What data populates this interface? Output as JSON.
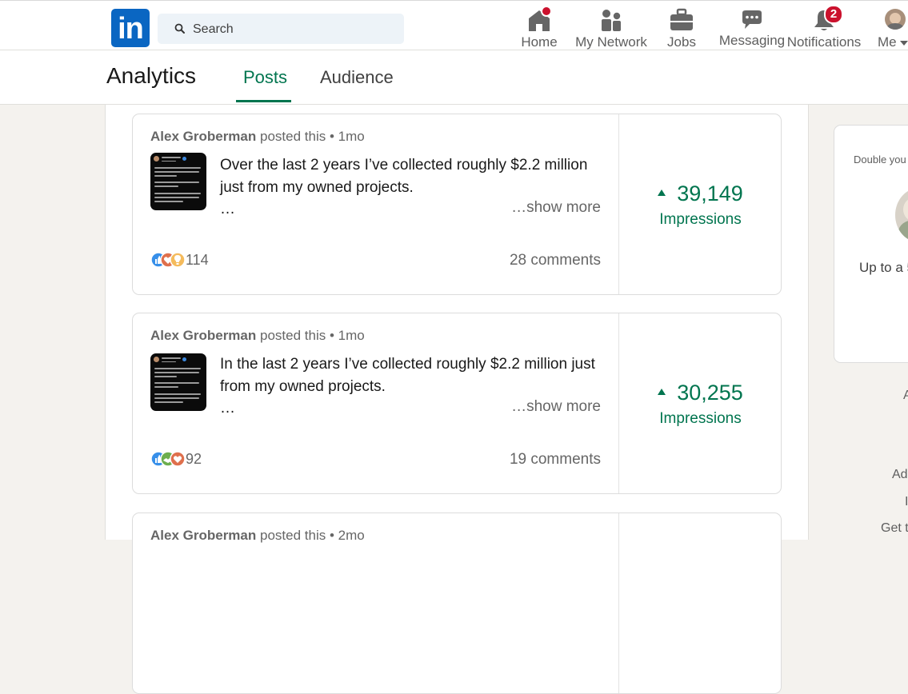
{
  "nav": {
    "logo_text": "in",
    "search_placeholder": "Search",
    "items": [
      {
        "label": "Home",
        "icon": "home-icon"
      },
      {
        "label": "My Network",
        "icon": "network-icon"
      },
      {
        "label": "Jobs",
        "icon": "briefcase-icon"
      },
      {
        "label": "Messaging",
        "icon": "messaging-icon"
      },
      {
        "label": "Notifications",
        "icon": "bell-icon",
        "badge": "2"
      },
      {
        "label": "Me",
        "icon": "avatar"
      }
    ]
  },
  "analytics": {
    "title": "Analytics",
    "tabs": [
      {
        "label": "Posts",
        "active": true
      },
      {
        "label": "Audience",
        "active": false
      }
    ]
  },
  "posts": [
    {
      "author": "Alex Groberman",
      "meta": "posted this • 1mo",
      "text": "Over the last 2 years I’ve collected roughly $2.2 million just from my owned projects.",
      "ellipsis": "…",
      "show_more": "…show more",
      "reaction_count": "114",
      "comments": "28 comments",
      "impressions": "39,149",
      "impressions_label": "Impressions"
    },
    {
      "author": "Alex Groberman",
      "meta": "posted this • 1mo",
      "text": "In the last 2 years I’ve collected roughly $2.2 million just from my owned projects.",
      "ellipsis": "…",
      "show_more": "…show more",
      "reaction_count": "92",
      "comments": "19 comments",
      "impressions": "30,255",
      "impressions_label": "Impressions"
    },
    {
      "author": "Alex Groberman",
      "meta": "posted this • 2mo"
    }
  ],
  "rail": {
    "ad_text": "Double you",
    "ad_offer": "Up to a 5",
    "lines": [
      "A",
      "Ad",
      "I",
      "Get t"
    ]
  },
  "colors": {
    "brand": "#0a66c2",
    "accent_green": "#01754f",
    "badge_red": "#cb112d"
  }
}
